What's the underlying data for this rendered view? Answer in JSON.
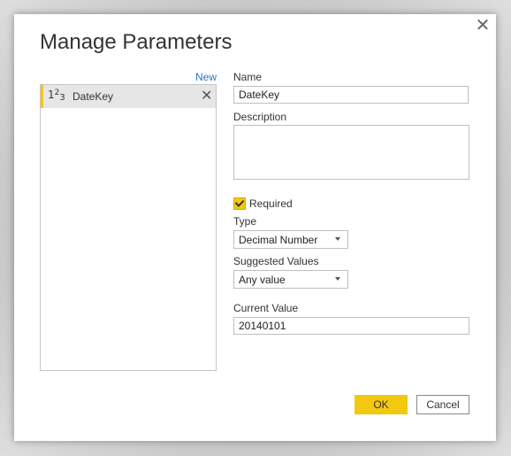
{
  "dialog": {
    "title": "Manage Parameters",
    "close_glyph": "✕"
  },
  "list": {
    "new_label": "New",
    "items": [
      {
        "type_icon": "number-type-icon",
        "type_glyph_base": "1",
        "type_glyph_sup": "2",
        "type_glyph_sub": "3",
        "label": "DateKey",
        "remove_glyph": "✕"
      }
    ]
  },
  "form": {
    "name_label": "Name",
    "name_value": "DateKey",
    "description_label": "Description",
    "description_value": "",
    "required_label": "Required",
    "required_checked": true,
    "type_label": "Type",
    "type_value": "Decimal Number",
    "suggested_label": "Suggested Values",
    "suggested_value": "Any value",
    "current_label": "Current Value",
    "current_value": "20140101"
  },
  "buttons": {
    "ok_label": "OK",
    "cancel_label": "Cancel"
  },
  "colors": {
    "accent": "#f2c811",
    "link": "#2478c6"
  }
}
